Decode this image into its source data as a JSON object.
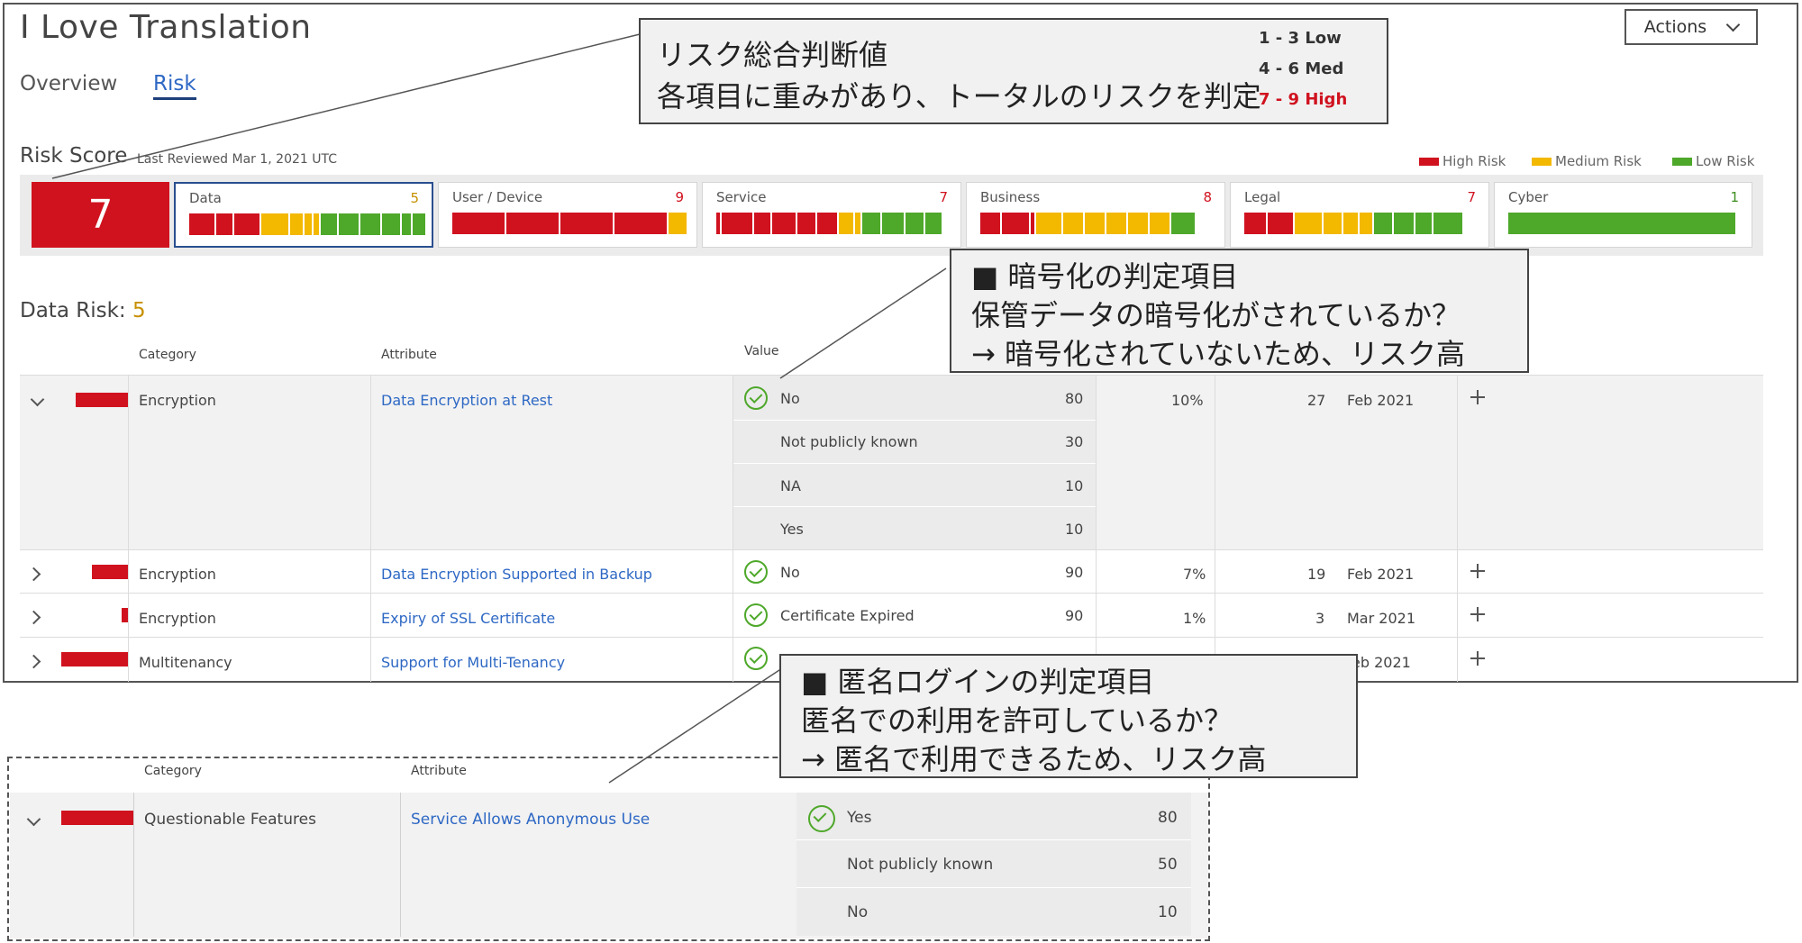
{
  "app": {
    "title": "I Love Translation",
    "tabs": [
      {
        "label": "Overview"
      },
      {
        "label": "Risk"
      }
    ],
    "actions_label": "Actions"
  },
  "risk_score": {
    "label": "Risk Score",
    "reviewed": "Last Reviewed Mar 1, 2021 UTC",
    "value": "7",
    "legend": [
      {
        "label": "High Risk",
        "color": "#d0121f"
      },
      {
        "label": "Medium Risk",
        "color": "#f3b800"
      },
      {
        "label": "Low Risk",
        "color": "#4ea82a"
      }
    ],
    "categories": [
      {
        "name": "Data",
        "score": "5",
        "score_color": "#c79000"
      },
      {
        "name": "User / Device",
        "score": "9",
        "score_color": "#d0121f"
      },
      {
        "name": "Service",
        "score": "7",
        "score_color": "#d0121f"
      },
      {
        "name": "Business",
        "score": "8",
        "score_color": "#d0121f"
      },
      {
        "name": "Legal",
        "score": "7",
        "score_color": "#d0121f"
      },
      {
        "name": "Cyber",
        "score": "1",
        "score_color": "#3f8e20"
      }
    ]
  },
  "callouts": {
    "score": {
      "line1": "リスク総合判断値",
      "line2": "各項目に重みがあり、トータルのリスクを判定",
      "ranges": [
        {
          "label": "1 - 3  Low",
          "color": "#333333"
        },
        {
          "label": "4 - 6  Med",
          "color": "#333333"
        },
        {
          "label": "7 - 9  High",
          "color": "#d0121f"
        }
      ]
    },
    "encryption": {
      "line1": "■ 暗号化の判定項目",
      "line2": "保管データの暗号化がされているか？",
      "line3": "→ 暗号化されていないため、リスク高"
    },
    "anonymous": {
      "line1": "■ 匿名ログインの判定項目",
      "line2": "匿名での利用を許可しているか？",
      "line3": "→ 匿名で利用できるため、リスク高"
    }
  },
  "data_risk": {
    "label": "Data Risk:",
    "value": "5",
    "headers": {
      "category": "Category",
      "attribute": "Attribute",
      "value": "Value"
    },
    "expanded_row": {
      "category": "Encryption",
      "attribute": "Data Encryption at Rest",
      "options": [
        {
          "label": "No",
          "score": "80"
        },
        {
          "label": "Not publicly known",
          "score": "30"
        },
        {
          "label": "NA",
          "score": "10"
        },
        {
          "label": "Yes",
          "score": "10"
        }
      ],
      "percent": "10%",
      "count": "27",
      "date": "Feb 2021"
    },
    "rows": [
      {
        "category": "Encryption",
        "attribute": "Data Encryption Supported in Backup",
        "value": "No",
        "score": "90",
        "percent": "7%",
        "count": "19",
        "date": "Feb 2021"
      },
      {
        "category": "Encryption",
        "attribute": "Expiry of SSL Certificate",
        "value": "Certificate Expired",
        "score": "90",
        "percent": "1%",
        "count": "3",
        "date": "Mar 2021"
      },
      {
        "category": "Multitenancy",
        "attribute": "Support for Multi-Tenancy",
        "date": "eb 2021"
      }
    ]
  },
  "detail": {
    "headers": {
      "category": "Category",
      "attribute": "Attribute"
    },
    "category": "Questionable Features",
    "attribute": "Service Allows Anonymous Use",
    "options": [
      {
        "label": "Yes",
        "score": "80"
      },
      {
        "label": "Not publicly known",
        "score": "50"
      },
      {
        "label": "No",
        "score": "10"
      }
    ]
  }
}
